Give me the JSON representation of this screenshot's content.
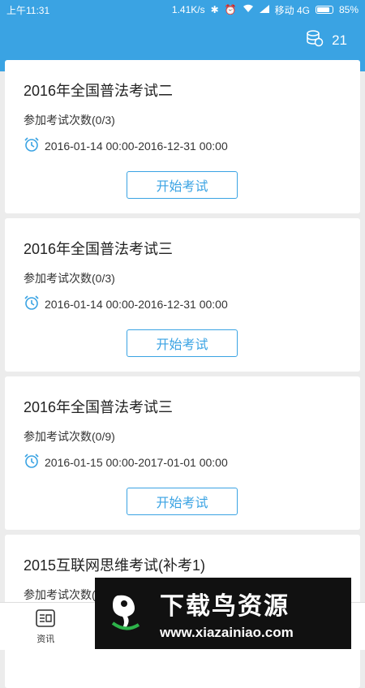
{
  "status_bar": {
    "time": "上午11:31",
    "speed": "1.41K/s",
    "network": "移动 4G",
    "battery": "85%"
  },
  "header": {
    "coin_count": "21"
  },
  "exams": [
    {
      "title": "2016年全国普法考试二",
      "attempts": "参加考试次数(0/3)",
      "period": "2016-01-14 00:00-2016-12-31 00:00",
      "button": "开始考试"
    },
    {
      "title": "2016年全国普法考试三",
      "attempts": "参加考试次数(0/3)",
      "period": "2016-01-14 00:00-2016-12-31 00:00",
      "button": "开始考试"
    },
    {
      "title": "2016年全国普法考试三",
      "attempts": "参加考试次数(0/9)",
      "period": "2016-01-15 00:00-2017-01-01 00:00",
      "button": "开始考试"
    },
    {
      "title": "2015互联网思维考试(补考1)",
      "attempts": "参加考试次数(",
      "period": "",
      "button": ""
    }
  ],
  "tabbar": {
    "tab1_label": "资讯"
  },
  "watermark": {
    "title": "下载鸟资源",
    "url": "www.xiazainiao.com"
  },
  "colors": {
    "primary": "#3aa3e3",
    "background": "#ececec"
  }
}
